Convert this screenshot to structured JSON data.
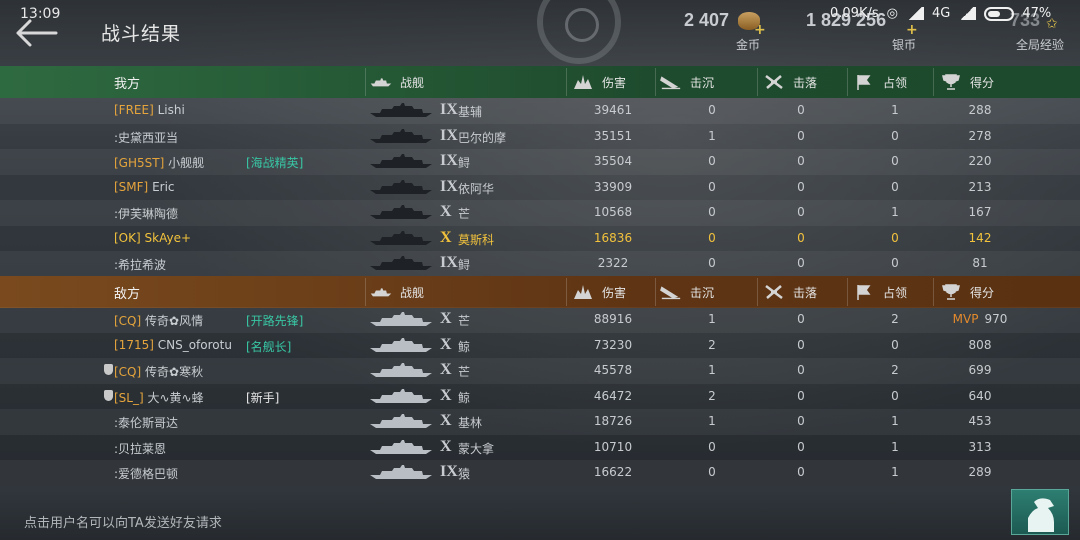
{
  "status_bar": {
    "time": "13:09",
    "network_speed": "0.09K/s",
    "network_type": "4G",
    "battery": "47%"
  },
  "header": {
    "title": "战斗结果",
    "currencies": [
      {
        "amount": "2 407",
        "label": "金币"
      },
      {
        "amount": "1 829 256",
        "label": "银币"
      },
      {
        "amount": "733",
        "label": "全局经验"
      }
    ]
  },
  "columns": {
    "ship": "战舰",
    "damage": "伤害",
    "sunk": "击沉",
    "downed": "击落",
    "capture": "占领",
    "score": "得分"
  },
  "allies": {
    "label": "我方",
    "rows": [
      {
        "clan": "[FREE]",
        "name": "Lishi",
        "badge": "",
        "tier": "IX",
        "ship": "基辅",
        "damage": "39461",
        "sunk": "0",
        "downed": "0",
        "capture": "1",
        "score": "288"
      },
      {
        "clan": "",
        "name": ":史黛西亚当",
        "badge": "",
        "tier": "IX",
        "ship": "巴尔的摩",
        "damage": "35151",
        "sunk": "1",
        "downed": "0",
        "capture": "0",
        "score": "278"
      },
      {
        "clan": "[GH5ST]",
        "name": "小舰舰",
        "badge": "[海战精英]",
        "tier": "IX",
        "ship": "鲟",
        "damage": "35504",
        "sunk": "0",
        "downed": "0",
        "capture": "0",
        "score": "220"
      },
      {
        "clan": "[SMF]",
        "name": "Eric",
        "badge": "",
        "tier": "IX",
        "ship": "依阿华",
        "damage": "33909",
        "sunk": "0",
        "downed": "0",
        "capture": "0",
        "score": "213"
      },
      {
        "clan": "",
        "name": ":伊芙琳陶德",
        "badge": "",
        "tier": "X",
        "ship": "芒",
        "damage": "10568",
        "sunk": "0",
        "downed": "0",
        "capture": "1",
        "score": "167"
      },
      {
        "clan": "[OK]",
        "name": "SkAye+",
        "badge": "",
        "tier": "X",
        "ship": "莫斯科",
        "damage": "16836",
        "sunk": "0",
        "downed": "0",
        "capture": "0",
        "score": "142",
        "highlight": true
      },
      {
        "clan": "",
        "name": ":希拉希波",
        "badge": "",
        "tier": "IX",
        "ship": "鲟",
        "damage": "2322",
        "sunk": "0",
        "downed": "0",
        "capture": "0",
        "score": "81"
      }
    ]
  },
  "enemies": {
    "label": "敌方",
    "rows": [
      {
        "clan": "[CQ]",
        "name": "传奇✿风情",
        "badge": "[开路先锋]",
        "tier": "X",
        "ship": "芒",
        "damage": "88916",
        "sunk": "1",
        "downed": "0",
        "capture": "2",
        "score": "970",
        "mvp": "MVP"
      },
      {
        "clan": "[1715]",
        "name": "CNS_oforotu",
        "badge": "[名舰长]",
        "tier": "X",
        "ship": "鲸",
        "damage": "73230",
        "sunk": "2",
        "downed": "0",
        "capture": "0",
        "score": "808"
      },
      {
        "clan": "[CQ]",
        "name": "传奇✿寒秋",
        "badge": "",
        "tier": "X",
        "ship": "芒",
        "damage": "45578",
        "sunk": "1",
        "downed": "0",
        "capture": "2",
        "score": "699",
        "shield": true
      },
      {
        "clan": "[SL_]",
        "name": "大∿黄∿蜂",
        "badge": "[新手]",
        "badge_plain": true,
        "tier": "X",
        "ship": "鲸",
        "damage": "46472",
        "sunk": "2",
        "downed": "0",
        "capture": "0",
        "score": "640",
        "shield": true
      },
      {
        "clan": "",
        "name": ":泰伦斯哥达",
        "badge": "",
        "tier": "X",
        "ship": "基林",
        "damage": "18726",
        "sunk": "1",
        "downed": "0",
        "capture": "1",
        "score": "453"
      },
      {
        "clan": "",
        "name": ":贝拉莱恩",
        "badge": "",
        "tier": "X",
        "ship": "蒙大拿",
        "damage": "10710",
        "sunk": "0",
        "downed": "0",
        "capture": "1",
        "score": "313"
      },
      {
        "clan": "",
        "name": ":爱德格巴顿",
        "badge": "",
        "tier": "IX",
        "ship": "猿",
        "damage": "16622",
        "sunk": "0",
        "downed": "0",
        "capture": "1",
        "score": "289"
      }
    ]
  },
  "footer": {
    "hint": "点击用户名可以向TA发送好友请求"
  },
  "colors": {
    "ally_header": "#2e6a40",
    "enemy_header": "#7a4a1e",
    "highlight": "#f2c23c",
    "clan": "#e5a43c",
    "badge": "#38c6a4",
    "mvp": "#e48a2c"
  },
  "icons": [
    "back-arrow-icon",
    "gold-coin-icon",
    "silver-coin-icon",
    "exp-star-icon",
    "ship-icon",
    "explosion-icon",
    "sinking-ship-icon",
    "plane-downed-icon",
    "flag-icon",
    "trophy-icon",
    "shield-icon",
    "captain-profile-icon"
  ]
}
